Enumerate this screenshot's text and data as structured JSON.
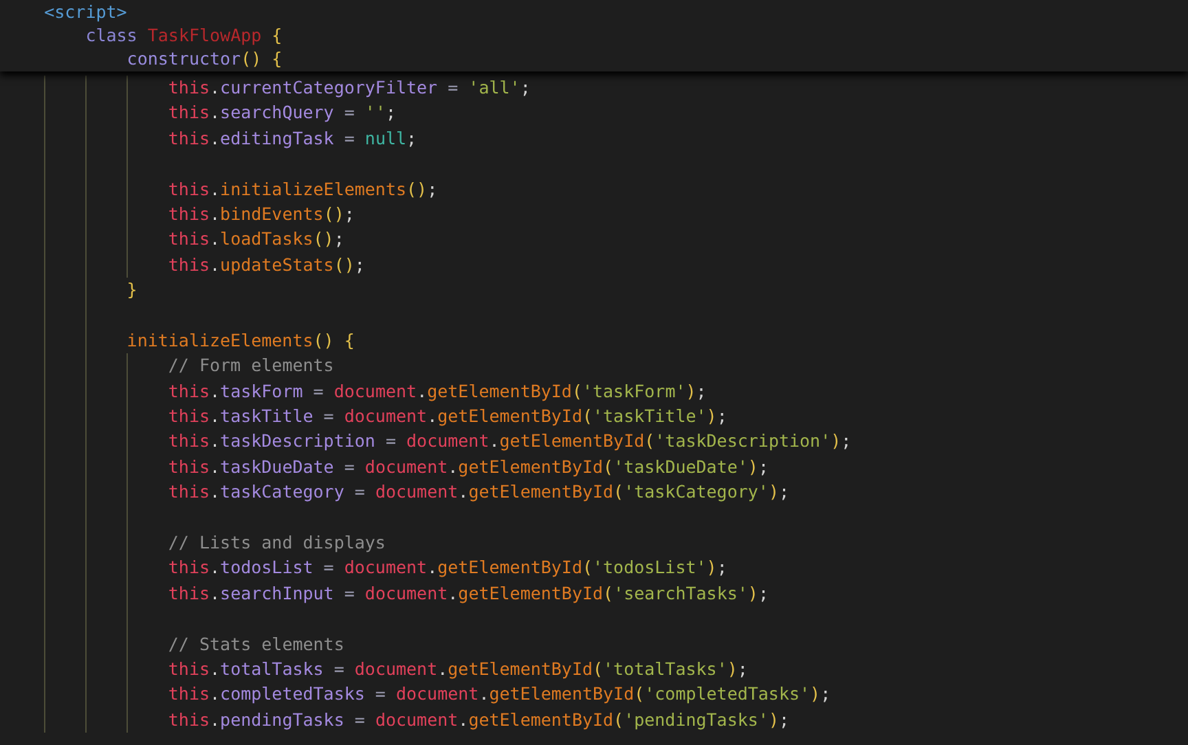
{
  "code": [
    {
      "kind": "code",
      "sticky": true,
      "tokens": [
        {
          "kind": "tag",
          "text": "<script>"
        }
      ],
      "children": [
        {
          "kind": "code",
          "sticky": true,
          "tokens": [
            {
              "kind": "keyword",
              "text": "class"
            },
            {
              "kind": "type",
              "text": " TaskFlowApp"
            },
            {
              "kind": "bracket",
              "text": " {"
            }
          ],
          "children": [
            {
              "kind": "code",
              "sticky": true,
              "tokens": [
                {
                  "kind": "method",
                  "text": "constructor"
                },
                {
                  "kind": "bracket",
                  "text": "() {"
                }
              ],
              "children": [
                {
                  "kind": "code",
                  "sticky": false,
                  "tokens": [
                    {
                      "kind": "this",
                      "text": "this"
                    },
                    {
                      "kind": "plain",
                      "text": "."
                    },
                    {
                      "kind": "property",
                      "text": "currentCategoryFilter"
                    },
                    {
                      "kind": "operator",
                      "text": " = "
                    },
                    {
                      "kind": "string",
                      "text": "'all'"
                    },
                    {
                      "kind": "plain",
                      "text": ";"
                    }
                  ]
                },
                {
                  "kind": "code",
                  "sticky": false,
                  "tokens": [
                    {
                      "kind": "this",
                      "text": "this"
                    },
                    {
                      "kind": "plain",
                      "text": "."
                    },
                    {
                      "kind": "property",
                      "text": "searchQuery"
                    },
                    {
                      "kind": "operator",
                      "text": " = "
                    },
                    {
                      "kind": "string",
                      "text": "''"
                    },
                    {
                      "kind": "plain",
                      "text": ";"
                    }
                  ]
                },
                {
                  "kind": "code",
                  "sticky": false,
                  "tokens": [
                    {
                      "kind": "this",
                      "text": "this"
                    },
                    {
                      "kind": "plain",
                      "text": "."
                    },
                    {
                      "kind": "property",
                      "text": "editingTask"
                    },
                    {
                      "kind": "operator",
                      "text": " = "
                    },
                    {
                      "kind": "null",
                      "text": "null"
                    },
                    {
                      "kind": "plain",
                      "text": ";"
                    }
                  ]
                },
                {
                  "kind": "blank",
                  "sticky": false
                },
                {
                  "kind": "code",
                  "sticky": false,
                  "tokens": [
                    {
                      "kind": "this",
                      "text": "this"
                    },
                    {
                      "kind": "plain",
                      "text": "."
                    },
                    {
                      "kind": "function",
                      "text": "initializeElements"
                    },
                    {
                      "kind": "bracket",
                      "text": "()"
                    },
                    {
                      "kind": "plain",
                      "text": ";"
                    }
                  ]
                },
                {
                  "kind": "code",
                  "sticky": false,
                  "tokens": [
                    {
                      "kind": "this",
                      "text": "this"
                    },
                    {
                      "kind": "plain",
                      "text": "."
                    },
                    {
                      "kind": "function",
                      "text": "bindEvents"
                    },
                    {
                      "kind": "bracket",
                      "text": "()"
                    },
                    {
                      "kind": "plain",
                      "text": ";"
                    }
                  ]
                },
                {
                  "kind": "code",
                  "sticky": false,
                  "tokens": [
                    {
                      "kind": "this",
                      "text": "this"
                    },
                    {
                      "kind": "plain",
                      "text": "."
                    },
                    {
                      "kind": "function",
                      "text": "loadTasks"
                    },
                    {
                      "kind": "bracket",
                      "text": "()"
                    },
                    {
                      "kind": "plain",
                      "text": ";"
                    }
                  ]
                },
                {
                  "kind": "code",
                  "sticky": false,
                  "tokens": [
                    {
                      "kind": "this",
                      "text": "this"
                    },
                    {
                      "kind": "plain",
                      "text": "."
                    },
                    {
                      "kind": "function",
                      "text": "updateStats"
                    },
                    {
                      "kind": "bracket",
                      "text": "()"
                    },
                    {
                      "kind": "plain",
                      "text": ";"
                    }
                  ]
                }
              ]
            },
            {
              "kind": "code",
              "sticky": false,
              "tokens": [
                {
                  "kind": "bracket",
                  "text": "}"
                }
              ]
            },
            {
              "kind": "blank",
              "sticky": false
            },
            {
              "kind": "code",
              "sticky": false,
              "tokens": [
                {
                  "kind": "function",
                  "text": "initializeElements"
                },
                {
                  "kind": "bracket",
                  "text": "() {"
                }
              ],
              "children": [
                {
                  "kind": "code",
                  "sticky": false,
                  "tokens": [
                    {
                      "kind": "comment",
                      "text": "// Form elements"
                    }
                  ]
                },
                {
                  "kind": "code",
                  "sticky": false,
                  "tokens": [
                    {
                      "kind": "this",
                      "text": "this"
                    },
                    {
                      "kind": "plain",
                      "text": "."
                    },
                    {
                      "kind": "property",
                      "text": "taskForm"
                    },
                    {
                      "kind": "operator",
                      "text": " = "
                    },
                    {
                      "kind": "this",
                      "text": "document"
                    },
                    {
                      "kind": "plain",
                      "text": "."
                    },
                    {
                      "kind": "function",
                      "text": "getElementById"
                    },
                    {
                      "kind": "bracket",
                      "text": "("
                    },
                    {
                      "kind": "string",
                      "text": "'taskForm'"
                    },
                    {
                      "kind": "bracket",
                      "text": ")"
                    },
                    {
                      "kind": "plain",
                      "text": ";"
                    }
                  ]
                },
                {
                  "kind": "code",
                  "sticky": false,
                  "tokens": [
                    {
                      "kind": "this",
                      "text": "this"
                    },
                    {
                      "kind": "plain",
                      "text": "."
                    },
                    {
                      "kind": "property",
                      "text": "taskTitle"
                    },
                    {
                      "kind": "operator",
                      "text": " = "
                    },
                    {
                      "kind": "this",
                      "text": "document"
                    },
                    {
                      "kind": "plain",
                      "text": "."
                    },
                    {
                      "kind": "function",
                      "text": "getElementById"
                    },
                    {
                      "kind": "bracket",
                      "text": "("
                    },
                    {
                      "kind": "string",
                      "text": "'taskTitle'"
                    },
                    {
                      "kind": "bracket",
                      "text": ")"
                    },
                    {
                      "kind": "plain",
                      "text": ";"
                    }
                  ]
                },
                {
                  "kind": "code",
                  "sticky": false,
                  "tokens": [
                    {
                      "kind": "this",
                      "text": "this"
                    },
                    {
                      "kind": "plain",
                      "text": "."
                    },
                    {
                      "kind": "property",
                      "text": "taskDescription"
                    },
                    {
                      "kind": "operator",
                      "text": " = "
                    },
                    {
                      "kind": "this",
                      "text": "document"
                    },
                    {
                      "kind": "plain",
                      "text": "."
                    },
                    {
                      "kind": "function",
                      "text": "getElementById"
                    },
                    {
                      "kind": "bracket",
                      "text": "("
                    },
                    {
                      "kind": "string",
                      "text": "'taskDescription'"
                    },
                    {
                      "kind": "bracket",
                      "text": ")"
                    },
                    {
                      "kind": "plain",
                      "text": ";"
                    }
                  ]
                },
                {
                  "kind": "code",
                  "sticky": false,
                  "tokens": [
                    {
                      "kind": "this",
                      "text": "this"
                    },
                    {
                      "kind": "plain",
                      "text": "."
                    },
                    {
                      "kind": "property",
                      "text": "taskDueDate"
                    },
                    {
                      "kind": "operator",
                      "text": " = "
                    },
                    {
                      "kind": "this",
                      "text": "document"
                    },
                    {
                      "kind": "plain",
                      "text": "."
                    },
                    {
                      "kind": "function",
                      "text": "getElementById"
                    },
                    {
                      "kind": "bracket",
                      "text": "("
                    },
                    {
                      "kind": "string",
                      "text": "'taskDueDate'"
                    },
                    {
                      "kind": "bracket",
                      "text": ")"
                    },
                    {
                      "kind": "plain",
                      "text": ";"
                    }
                  ]
                },
                {
                  "kind": "code",
                  "sticky": false,
                  "tokens": [
                    {
                      "kind": "this",
                      "text": "this"
                    },
                    {
                      "kind": "plain",
                      "text": "."
                    },
                    {
                      "kind": "property",
                      "text": "taskCategory"
                    },
                    {
                      "kind": "operator",
                      "text": " = "
                    },
                    {
                      "kind": "this",
                      "text": "document"
                    },
                    {
                      "kind": "plain",
                      "text": "."
                    },
                    {
                      "kind": "function",
                      "text": "getElementById"
                    },
                    {
                      "kind": "bracket",
                      "text": "("
                    },
                    {
                      "kind": "string",
                      "text": "'taskCategory'"
                    },
                    {
                      "kind": "bracket",
                      "text": ")"
                    },
                    {
                      "kind": "plain",
                      "text": ";"
                    }
                  ]
                },
                {
                  "kind": "blank",
                  "sticky": false
                },
                {
                  "kind": "code",
                  "sticky": false,
                  "tokens": [
                    {
                      "kind": "comment",
                      "text": "// Lists and displays"
                    }
                  ]
                },
                {
                  "kind": "code",
                  "sticky": false,
                  "tokens": [
                    {
                      "kind": "this",
                      "text": "this"
                    },
                    {
                      "kind": "plain",
                      "text": "."
                    },
                    {
                      "kind": "property",
                      "text": "todosList"
                    },
                    {
                      "kind": "operator",
                      "text": " = "
                    },
                    {
                      "kind": "this",
                      "text": "document"
                    },
                    {
                      "kind": "plain",
                      "text": "."
                    },
                    {
                      "kind": "function",
                      "text": "getElementById"
                    },
                    {
                      "kind": "bracket",
                      "text": "("
                    },
                    {
                      "kind": "string",
                      "text": "'todosList'"
                    },
                    {
                      "kind": "bracket",
                      "text": ")"
                    },
                    {
                      "kind": "plain",
                      "text": ";"
                    }
                  ]
                },
                {
                  "kind": "code",
                  "sticky": false,
                  "tokens": [
                    {
                      "kind": "this",
                      "text": "this"
                    },
                    {
                      "kind": "plain",
                      "text": "."
                    },
                    {
                      "kind": "property",
                      "text": "searchInput"
                    },
                    {
                      "kind": "operator",
                      "text": " = "
                    },
                    {
                      "kind": "this",
                      "text": "document"
                    },
                    {
                      "kind": "plain",
                      "text": "."
                    },
                    {
                      "kind": "function",
                      "text": "getElementById"
                    },
                    {
                      "kind": "bracket",
                      "text": "("
                    },
                    {
                      "kind": "string",
                      "text": "'searchTasks'"
                    },
                    {
                      "kind": "bracket",
                      "text": ")"
                    },
                    {
                      "kind": "plain",
                      "text": ";"
                    }
                  ]
                },
                {
                  "kind": "blank",
                  "sticky": false
                },
                {
                  "kind": "code",
                  "sticky": false,
                  "tokens": [
                    {
                      "kind": "comment",
                      "text": "// Stats elements"
                    }
                  ]
                },
                {
                  "kind": "code",
                  "sticky": false,
                  "tokens": [
                    {
                      "kind": "this",
                      "text": "this"
                    },
                    {
                      "kind": "plain",
                      "text": "."
                    },
                    {
                      "kind": "property",
                      "text": "totalTasks"
                    },
                    {
                      "kind": "operator",
                      "text": " = "
                    },
                    {
                      "kind": "this",
                      "text": "document"
                    },
                    {
                      "kind": "plain",
                      "text": "."
                    },
                    {
                      "kind": "function",
                      "text": "getElementById"
                    },
                    {
                      "kind": "bracket",
                      "text": "("
                    },
                    {
                      "kind": "string",
                      "text": "'totalTasks'"
                    },
                    {
                      "kind": "bracket",
                      "text": ")"
                    },
                    {
                      "kind": "plain",
                      "text": ";"
                    }
                  ]
                },
                {
                  "kind": "code",
                  "sticky": false,
                  "tokens": [
                    {
                      "kind": "this",
                      "text": "this"
                    },
                    {
                      "kind": "plain",
                      "text": "."
                    },
                    {
                      "kind": "property",
                      "text": "completedTasks"
                    },
                    {
                      "kind": "operator",
                      "text": " = "
                    },
                    {
                      "kind": "this",
                      "text": "document"
                    },
                    {
                      "kind": "plain",
                      "text": "."
                    },
                    {
                      "kind": "function",
                      "text": "getElementById"
                    },
                    {
                      "kind": "bracket",
                      "text": "("
                    },
                    {
                      "kind": "string",
                      "text": "'completedTasks'"
                    },
                    {
                      "kind": "bracket",
                      "text": ")"
                    },
                    {
                      "kind": "plain",
                      "text": ";"
                    }
                  ]
                },
                {
                  "kind": "code",
                  "sticky": false,
                  "tokens": [
                    {
                      "kind": "this",
                      "text": "this"
                    },
                    {
                      "kind": "plain",
                      "text": "."
                    },
                    {
                      "kind": "property",
                      "text": "pendingTasks"
                    },
                    {
                      "kind": "operator",
                      "text": " = "
                    },
                    {
                      "kind": "this",
                      "text": "document"
                    },
                    {
                      "kind": "plain",
                      "text": "."
                    },
                    {
                      "kind": "function",
                      "text": "getElementById"
                    },
                    {
                      "kind": "bracket",
                      "text": "("
                    },
                    {
                      "kind": "string",
                      "text": "'pendingTasks'"
                    },
                    {
                      "kind": "bracket",
                      "text": ")"
                    },
                    {
                      "kind": "plain",
                      "text": ";"
                    }
                  ]
                }
              ]
            }
          ]
        }
      ]
    }
  ]
}
